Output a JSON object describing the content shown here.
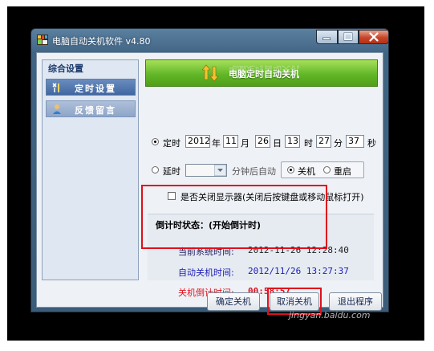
{
  "window": {
    "title": "电脑自动关机软件 v4.80"
  },
  "sidebar": {
    "header": "综合设置",
    "items": [
      {
        "label": "定时设置",
        "icon": "tools-icon",
        "selected": true
      },
      {
        "label": "反馈留言",
        "icon": "user-icon",
        "selected": false
      }
    ]
  },
  "banner": {
    "title": "电脑定时自动关机",
    "icon": "up-down-arrows-icon"
  },
  "timer": {
    "label": "定时",
    "selected": true,
    "year": "2012",
    "year_unit": "年",
    "month": "11",
    "month_unit": "月",
    "day": "26",
    "day_unit": "日",
    "hour": "13",
    "hour_unit": "时",
    "minute": "27",
    "minute_unit": "分",
    "second": "37",
    "second_unit": "秒"
  },
  "delay": {
    "label": "延时",
    "selected": false,
    "value": "",
    "suffix": "分钟后自动",
    "shutdown_label": "关机",
    "shutdown_selected": true,
    "restart_label": "重启",
    "restart_selected": false
  },
  "monitor": {
    "label": "是否关闭显示器(关闭后按键盘或移动鼠标打开)",
    "checked": false
  },
  "status": {
    "title": "倒计时状态：(开始倒计时)",
    "current_time_label": "当前系统时间:",
    "current_time_value": "2012-11-26 12:28:40",
    "shutdown_time_label": "自动关机时间:",
    "shutdown_time_value": "2012/11/26 13:27:37",
    "countdown_label": "关机倒计时间:",
    "countdown_value": "00:58:57"
  },
  "buttons": {
    "confirm": "确定关机",
    "cancel": "取消关机",
    "exit": "退出程序"
  },
  "watermark": "jingyan.baidu.com",
  "colors": {
    "highlight_box": "#e0101c",
    "banner_green": "#62b728",
    "shutdown_time_blue": "#1a1ab4",
    "countdown_red": "#e0101c"
  }
}
